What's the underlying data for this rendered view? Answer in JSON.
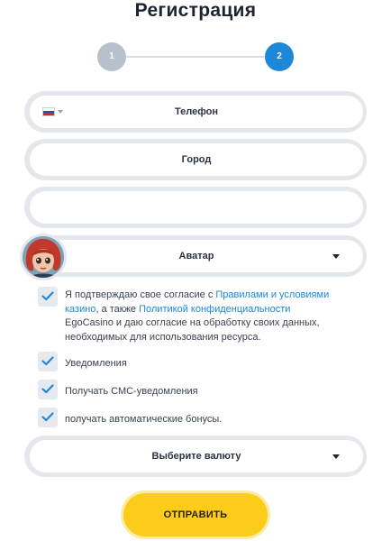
{
  "title": "Регистрация",
  "steps": {
    "one": "1",
    "two": "2"
  },
  "fields": {
    "phone_label": "Телефон",
    "city_label": "Город",
    "blank_value": "",
    "avatar_label": "Аватар",
    "currency_label": "Выберите валюту"
  },
  "agreement": {
    "part1": "Я подтверждаю свое согласие с ",
    "rules_link": "Правилами и условиями казино",
    "part2": ", а также ",
    "privacy_link": "Политикой конфиденциальности",
    "part3": " EgoCasino и даю согласие на обработку своих данных, необходимых для использования ресурса."
  },
  "options": {
    "notifications": "Уведомления",
    "sms": "Получать СМС-уведомления",
    "bonuses": "получать автоматические бонусы."
  },
  "submit_label": "ОТПРАВИТЬ",
  "colors": {
    "accent": "#1e88d8",
    "button": "#fbcc1a",
    "step_inactive": "#b7c1cc"
  },
  "icons": {
    "flag": "russia-flag-icon",
    "dropdown": "caret-down-icon",
    "check": "checkmark-icon"
  }
}
